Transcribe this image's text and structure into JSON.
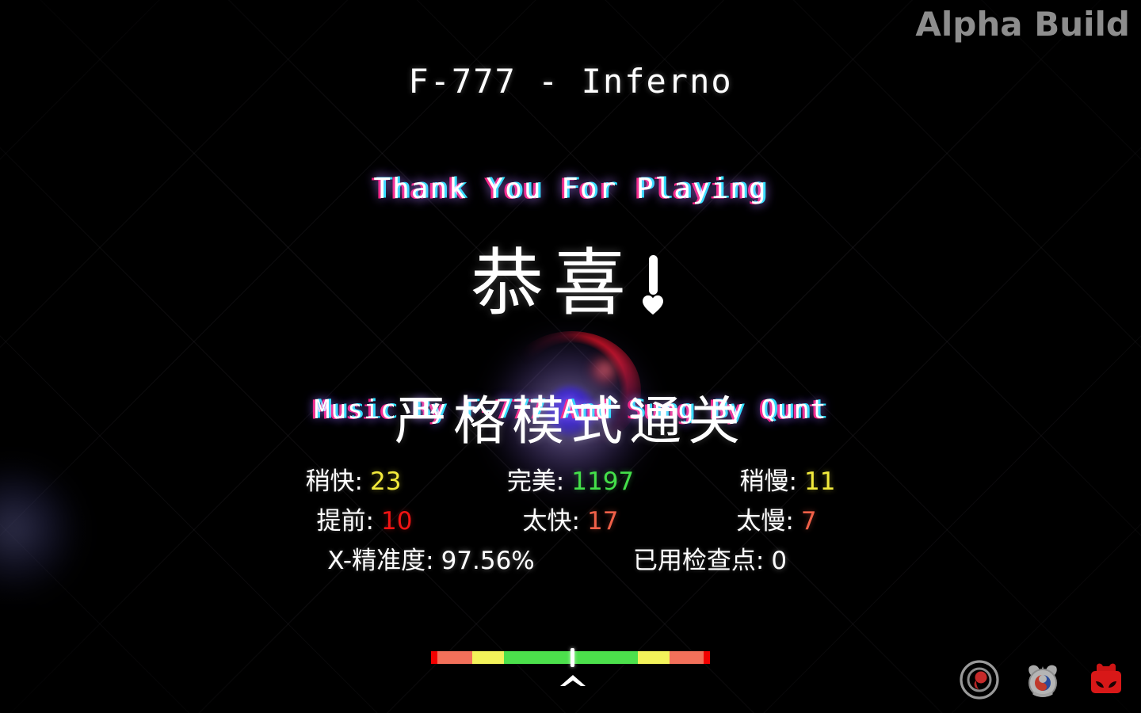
{
  "watermark": {
    "label": "Alpha Build",
    "color": "#8d8d8d"
  },
  "song": {
    "title": "F-777 - Inferno"
  },
  "thanks": {
    "text": "Thank You For Playing"
  },
  "congrats": {
    "text": "恭喜",
    "punctuation": "!"
  },
  "credits": {
    "text": "Music By F-777 And Sung By Qunt"
  },
  "clear_banner": {
    "text": "严格模式通关"
  },
  "stats": {
    "rows": [
      [
        {
          "label": "稍快:",
          "value": "23",
          "color": "#f2ea3c",
          "name": "stat-slightly-early"
        },
        {
          "label": "完美:",
          "value": "1197",
          "color": "#44e04a",
          "name": "stat-perfect"
        },
        {
          "label": "稍慢:",
          "value": "11",
          "color": "#f2ea3c",
          "name": "stat-slightly-late"
        }
      ],
      [
        {
          "label": "提前:",
          "value": "10",
          "color": "#f21414",
          "name": "stat-early"
        },
        {
          "label": "太快:",
          "value": "17",
          "color": "#f06048",
          "name": "stat-too-fast"
        },
        {
          "label": "太慢:",
          "value": "7",
          "color": "#f06048",
          "name": "stat-too-slow"
        }
      ],
      [
        {
          "label": "X-精准度:",
          "value": "97.56%",
          "color": "#ffffff",
          "name": "stat-accuracy"
        },
        {
          "label": "已用检查点:",
          "value": "0",
          "color": "#ffffff",
          "name": "stat-checkpoints-used"
        }
      ]
    ]
  },
  "timing_bar": {
    "segments": [
      {
        "color": "#f20000",
        "width_pct": 2.3
      },
      {
        "color": "#f2705a",
        "width_pct": 12.5
      },
      {
        "color": "#f2f25a",
        "width_pct": 11.4
      },
      {
        "color": "#4ce04c",
        "width_pct": 48.0
      },
      {
        "color": "#f2f25a",
        "width_pct": 11.4
      },
      {
        "color": "#f2705a",
        "width_pct": 12.1
      },
      {
        "color": "#f20000",
        "width_pct": 2.3
      }
    ],
    "marker_pct": 50.8,
    "chevron": "chevron-up"
  },
  "corner_icons": [
    {
      "name": "target-record-icon",
      "label": "target"
    },
    {
      "name": "robot-taiji-icon",
      "label": "robot"
    },
    {
      "name": "red-face-box-icon",
      "label": "face"
    }
  ]
}
